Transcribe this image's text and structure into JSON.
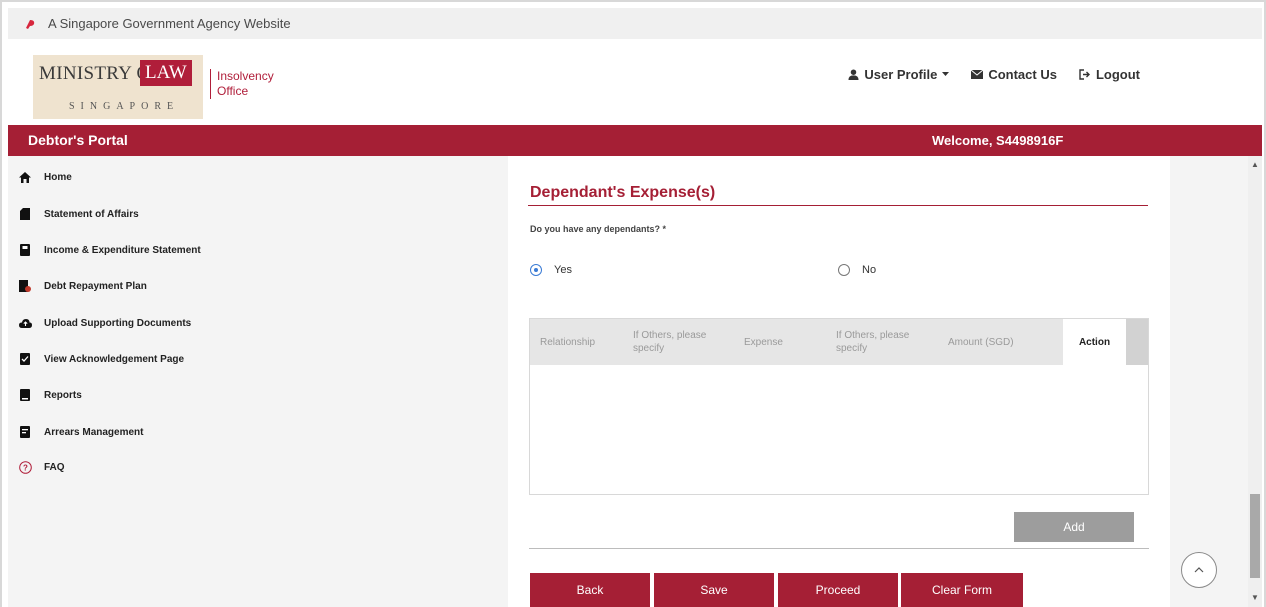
{
  "masthead": {
    "text": "A Singapore Government Agency Website",
    "icon": "lion-head-icon"
  },
  "logo": {
    "ministry": "MINISTRY OF",
    "law": "LAW",
    "country": "SINGAPORE",
    "sub_line1": "Insolvency",
    "sub_line2": "Office"
  },
  "topnav": {
    "user_profile": "User Profile",
    "contact_us": "Contact Us",
    "logout": "Logout"
  },
  "portal": {
    "title": "Debtor's Portal",
    "welcome": "Welcome, S4498916F"
  },
  "sidebar": {
    "items": [
      {
        "label": "Home",
        "icon": "home-icon"
      },
      {
        "label": "Statement of Affairs",
        "icon": "document-icon"
      },
      {
        "label": "Income & Expenditure Statement",
        "icon": "ledger-icon"
      },
      {
        "label": "Debt Repayment Plan",
        "icon": "plan-icon"
      },
      {
        "label": "Upload Supporting Documents",
        "icon": "cloud-upload-icon"
      },
      {
        "label": "View Acknowledgement Page",
        "icon": "acknowledgement-icon"
      },
      {
        "label": "Reports",
        "icon": "report-icon"
      },
      {
        "label": "Arrears Management",
        "icon": "arrears-icon"
      },
      {
        "label": "FAQ",
        "icon": "question-icon"
      }
    ]
  },
  "form": {
    "section_title": "Dependant's Expense(s)",
    "question": "Do you have any dependants? *",
    "options": [
      {
        "label": "Yes",
        "selected": true
      },
      {
        "label": "No",
        "selected": false
      }
    ],
    "table": {
      "columns": [
        "Relationship",
        "If Others, please specify",
        "Expense",
        "If Others, please specify",
        "Amount (SGD)",
        "Action"
      ],
      "rows": []
    },
    "add_label": "Add",
    "buttons": {
      "back": "Back",
      "save": "Save",
      "proceed": "Proceed",
      "clear": "Clear Form"
    }
  },
  "colors": {
    "brand": "#a51f35",
    "radio_selected": "#3a7bd5",
    "disabled_button": "#9d9d9d"
  }
}
